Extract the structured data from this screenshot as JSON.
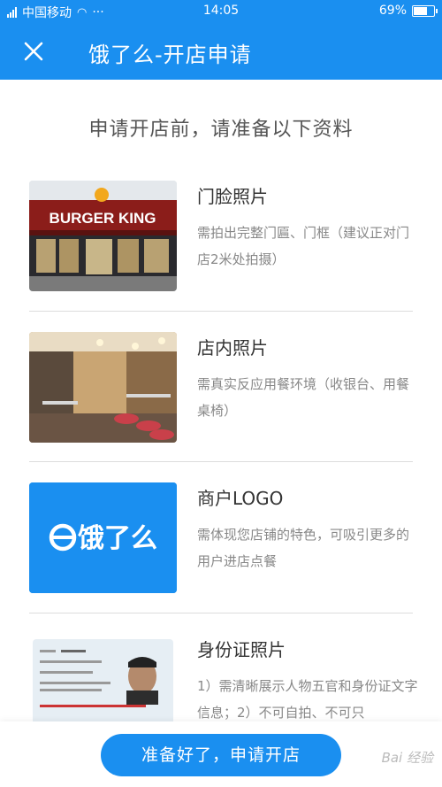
{
  "status": {
    "carrier": "中国移动",
    "time": "14:05",
    "battery": "69%",
    "battery_level": 0.69
  },
  "header": {
    "title": "饿了么-开店申请"
  },
  "intro": "申请开店前，请准备以下资料",
  "items": [
    {
      "title": "门脸照片",
      "desc": "需拍出完整门匾、门框（建议正对门店2米处拍摄）",
      "image": {
        "sign_text": "BURGER KING"
      }
    },
    {
      "title": "店内照片",
      "desc": "需真实反应用餐环境（收银台、用餐桌椅）"
    },
    {
      "title": "商户LOGO",
      "desc": "需体现您店铺的特色，可吸引更多的用户进店点餐",
      "image": {
        "logo_text": "饿了么"
      }
    },
    {
      "title": "身份证照片",
      "desc": "1）需清晰展示人物五官和身份证文字信息；2）不可自拍、不可只"
    }
  ],
  "cta": {
    "label": "准备好了，申请开店"
  },
  "watermark": "Bai 经验",
  "colors": {
    "brand_blue": "#1a8ff0"
  }
}
